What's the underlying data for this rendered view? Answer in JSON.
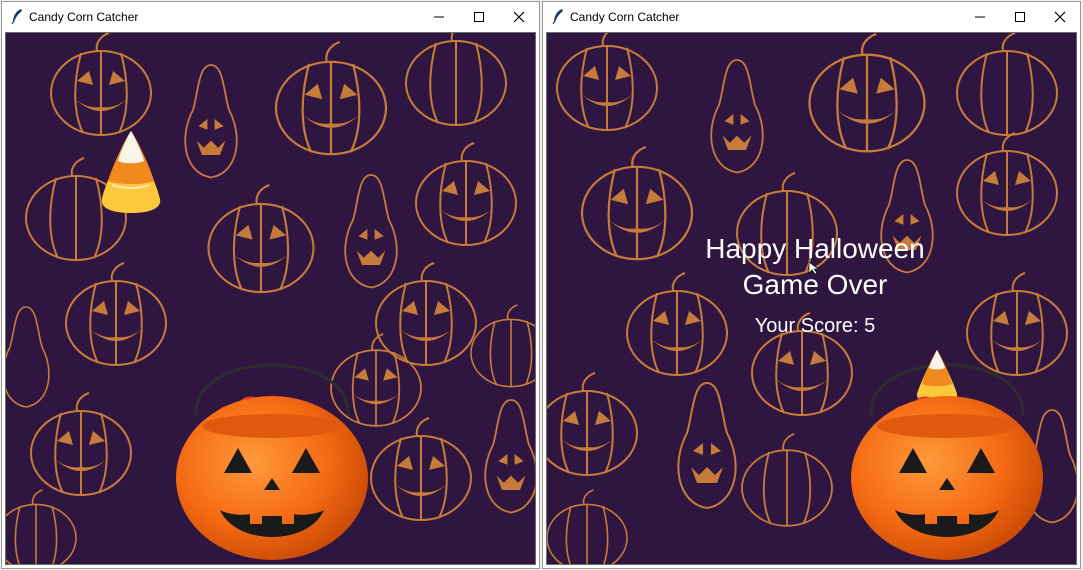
{
  "windows": [
    {
      "title": "Candy Corn Catcher",
      "state": "playing"
    },
    {
      "title": "Candy Corn Catcher",
      "state": "game-over",
      "game_over": {
        "line1": "Happy Halloween",
        "line2": "Game Over",
        "score_text": "Your Score: 5"
      }
    }
  ],
  "colors": {
    "background": "#2f1641",
    "pattern": "#c77b3a",
    "bucket": "#f56a14",
    "candy_yellow": "#fcc93c",
    "candy_orange": "#f0891e"
  },
  "icons": [
    "feather-icon",
    "minimize-icon",
    "maximize-icon",
    "close-icon"
  ]
}
